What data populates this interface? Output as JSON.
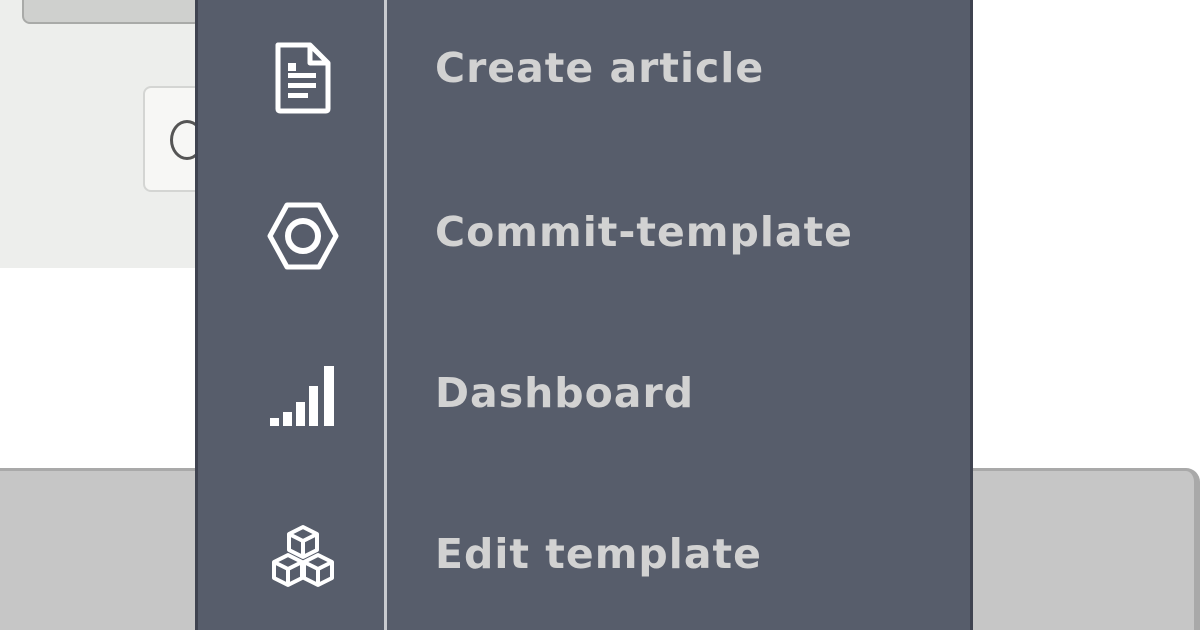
{
  "menu": {
    "items": [
      {
        "label": "Create article",
        "icon": "document-icon"
      },
      {
        "label": "Commit-template",
        "icon": "hexagon-nut-icon"
      },
      {
        "label": "Dashboard",
        "icon": "signal-bars-icon"
      },
      {
        "label": "Edit template",
        "icon": "cubes-icon"
      }
    ],
    "colors": {
      "background": "#575d6b",
      "text": "#d2d2d2",
      "icon": "#ffffff",
      "divider": "#c9cbd0"
    }
  }
}
